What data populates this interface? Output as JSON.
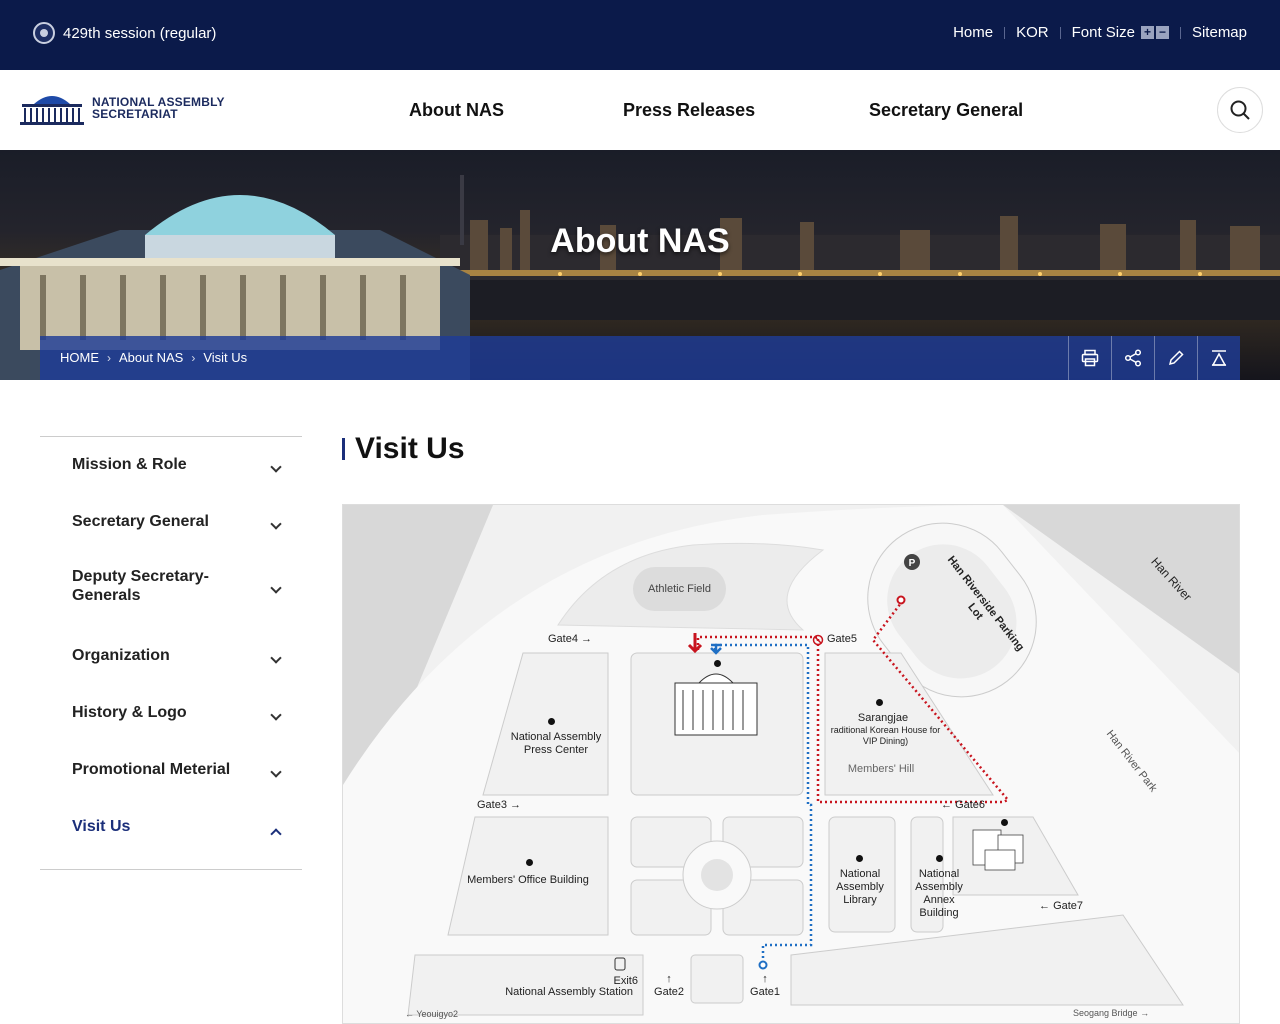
{
  "topbar": {
    "session": "429th session (regular)",
    "links": {
      "home": "Home",
      "kor": "KOR",
      "font_size": "Font Size",
      "sitemap": "Sitemap"
    },
    "font_plus": "+",
    "font_minus": "−"
  },
  "header": {
    "logo_line1": "NATIONAL ASSEMBLY",
    "logo_line2": "SECRETARIAT",
    "nav": [
      "About NAS",
      "Press Releases",
      "Secretary General"
    ]
  },
  "hero": {
    "title": "About NAS",
    "breadcrumb": [
      "HOME",
      "About NAS",
      "Visit Us"
    ]
  },
  "tools": [
    "print-icon",
    "share-icon",
    "edit-icon",
    "top-icon"
  ],
  "sidebar": {
    "items": [
      {
        "label": "Mission & Role",
        "expanded": false
      },
      {
        "label": "Secretary General",
        "expanded": false
      },
      {
        "label": "Deputy Secretary-Generals",
        "expanded": false
      },
      {
        "label": "Organization",
        "expanded": false
      },
      {
        "label": "History & Logo",
        "expanded": false
      },
      {
        "label": "Promotional Meterial",
        "expanded": false
      },
      {
        "label": "Visit Us",
        "expanded": true,
        "active": true
      }
    ]
  },
  "main": {
    "title": "Visit Us"
  },
  "map": {
    "athletic_field": "Athletic Field",
    "parking": "Han Riverside Parking Lot",
    "han_river": "Han River",
    "han_river_park": "Han River Park",
    "gates": {
      "gate1": "Gate1",
      "gate2": "Gate2",
      "gate3": "Gate3",
      "gate4": "Gate4",
      "gate5": "Gate5",
      "gate6": "Gate6",
      "gate7": "Gate7"
    },
    "press_center": "National Assembly Press Center",
    "sarangjae": "Sarangjae",
    "sarangjae_sub": "raditional Korean House for VIP Dining)",
    "members_hill": "Members' Hill",
    "office_building": "Members' Office Building",
    "library": "National Assembly Library",
    "annex": "National Assembly Annex Building",
    "exit": "Exit6",
    "station": "National Assembly Station",
    "yeouigyo": "Yeouigyo2",
    "seogang": "Seogang Bridge"
  },
  "colors": {
    "navy": "#0b1a4a",
    "accent": "#1b2f7a",
    "route_red": "#c8141e",
    "route_blue": "#1f6fc4"
  }
}
